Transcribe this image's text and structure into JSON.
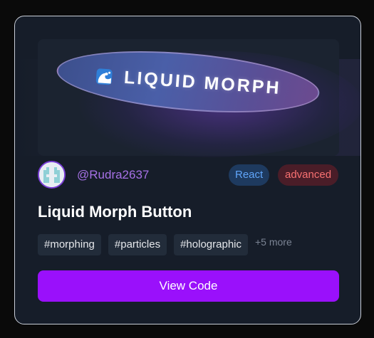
{
  "preview": {
    "button_label": "LIQUID MORPH",
    "icon": "wave-icon"
  },
  "author": {
    "handle": "@Rudra2637",
    "avatar_icon": "avatar-icon"
  },
  "tags": {
    "framework": "React",
    "level": "advanced"
  },
  "component": {
    "title": "Liquid Morph Button"
  },
  "hashtags": [
    "#morphing",
    "#particles",
    "#holographic"
  ],
  "more_label": "+5 more",
  "action": {
    "view_code_label": "View Code"
  },
  "colors": {
    "accent": "#9a10fb",
    "card_bg": "#161d29",
    "react_text": "#60a5fa",
    "advanced_text": "#f87171",
    "author_text": "#a671e6"
  }
}
